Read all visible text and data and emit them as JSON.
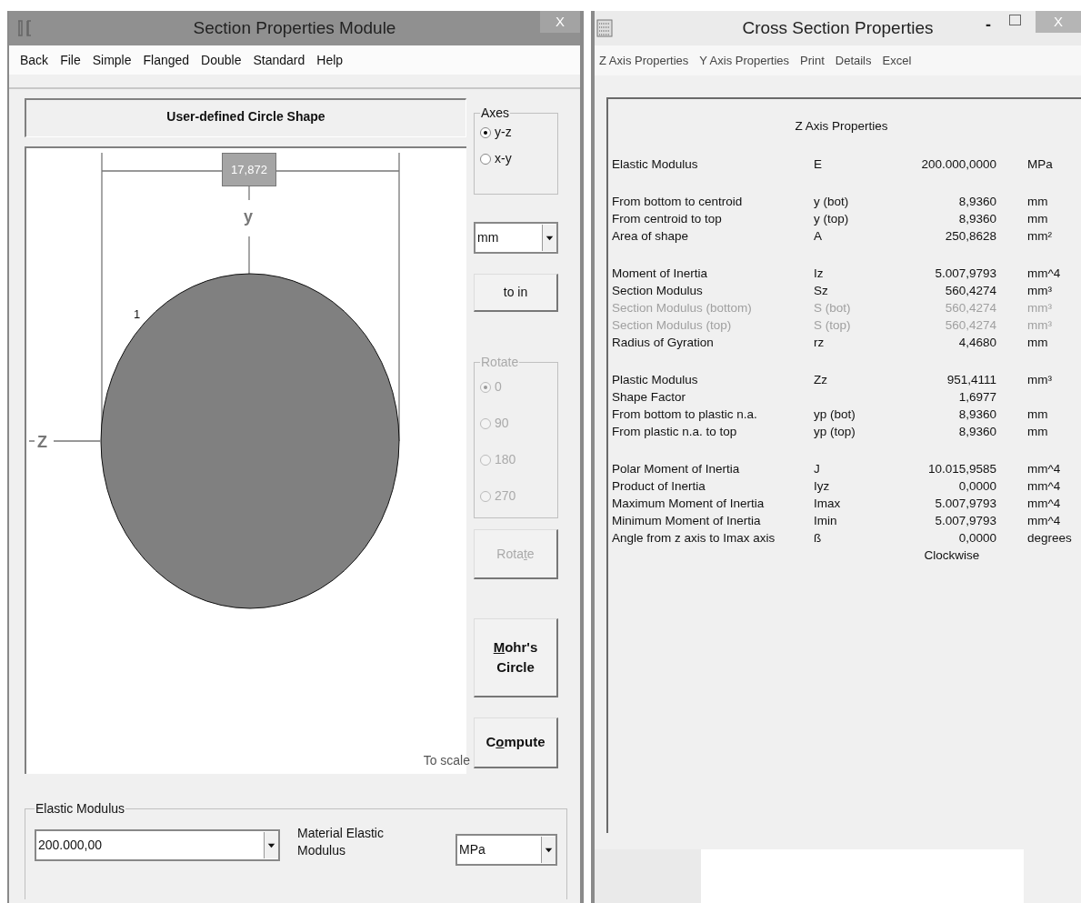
{
  "left_window": {
    "title": "Section Properties Module",
    "close": "X",
    "menu": [
      "Back",
      "File",
      "Simple",
      "Flanged",
      "Double",
      "Standard",
      "Help"
    ],
    "shape_title": "User-defined Circle Shape",
    "drawing": {
      "dimension": "17,872",
      "y_axis": "y",
      "z_axis": "Z",
      "point": "1",
      "scale_note": "To scale"
    },
    "axes": {
      "label": "Axes",
      "options": [
        {
          "label": "y-z",
          "selected": true
        },
        {
          "label": "x-y",
          "selected": false
        }
      ]
    },
    "unit_select": "mm",
    "convert_button": "to in",
    "rotate": {
      "label": "Rotate",
      "disabled": true,
      "options": [
        {
          "label": "0",
          "selected": true
        },
        {
          "label": "90",
          "selected": false
        },
        {
          "label": "180",
          "selected": false
        },
        {
          "label": "270",
          "selected": false
        }
      ]
    },
    "buttons": [
      {
        "kind": "rotate",
        "label": "Rotate",
        "disabled": true
      },
      {
        "kind": "mohr",
        "label": "Mohr's Circle",
        "disabled": false
      },
      {
        "kind": "compute",
        "label": "Compute",
        "disabled": false
      }
    ],
    "elastic_modulus": {
      "label": "Elastic Modulus",
      "value": "200.000,00",
      "description": "Material Elastic Modulus",
      "unit": "MPa"
    }
  },
  "right_window": {
    "title": "Cross Section Properties",
    "minimize": "-",
    "close": "X",
    "menu": [
      "Z Axis Properties",
      "Y Axis Properties",
      "Print",
      "Details",
      "Excel"
    ],
    "heading": "Z Axis Properties",
    "groups": [
      [
        {
          "label": "Elastic Modulus",
          "symbol": "E",
          "value": "200.000,0000",
          "unit": "MPa",
          "disabled": false
        }
      ],
      [
        {
          "label": "From bottom to centroid",
          "symbol": "y (bot)",
          "value": "8,9360",
          "unit": "mm",
          "disabled": false
        },
        {
          "label": "From centroid to top",
          "symbol": "y (top)",
          "value": "8,9360",
          "unit": "mm",
          "disabled": false
        },
        {
          "label": "Area of shape",
          "symbol": "A",
          "value": "250,8628",
          "unit": "mm²",
          "disabled": false
        }
      ],
      [
        {
          "label": "Moment of Inertia",
          "symbol": "Iz",
          "value": "5.007,9793",
          "unit": "mm^4",
          "disabled": false
        },
        {
          "label": "Section Modulus",
          "symbol": "Sz",
          "value": "560,4274",
          "unit": "mm³",
          "disabled": false
        },
        {
          "label": "Section Modulus (bottom)",
          "symbol": "S (bot)",
          "value": "560,4274",
          "unit": "mm³",
          "disabled": true
        },
        {
          "label": "Section Modulus (top)",
          "symbol": "S (top)",
          "value": "560,4274",
          "unit": "mm³",
          "disabled": true
        },
        {
          "label": "Radius of Gyration",
          "symbol": "rz",
          "value": "4,4680",
          "unit": "mm",
          "disabled": false
        }
      ],
      [
        {
          "label": "Plastic Modulus",
          "symbol": "Zz",
          "value": "951,4111",
          "unit": "mm³",
          "disabled": false
        },
        {
          "label": "Shape Factor",
          "value": "1,6977",
          "disabled": false
        },
        {
          "label": "From bottom to plastic n.a.",
          "symbol": "yp (bot)",
          "value": "8,9360",
          "unit": "mm",
          "disabled": false
        },
        {
          "label": "From plastic n.a. to top",
          "symbol": "yp (top)",
          "value": "8,9360",
          "unit": "mm",
          "disabled": false
        }
      ],
      [
        {
          "label": "Polar Moment of Inertia",
          "symbol": "J",
          "value": "10.015,9585",
          "unit": "mm^4",
          "disabled": false
        },
        {
          "label": "Product of Inertia",
          "symbol": "Iyz",
          "value": "0,0000",
          "unit": "mm^4",
          "disabled": false
        },
        {
          "label": "Maximum Moment of Inertia",
          "symbol": "Imax",
          "value": "5.007,9793",
          "unit": "mm^4",
          "disabled": false
        },
        {
          "label": "Minimum Moment of Inertia",
          "symbol": "Imin",
          "value": "5.007,9793",
          "unit": "mm^4",
          "disabled": false
        },
        {
          "label": "Angle from z axis to Imax axis",
          "symbol": "ß",
          "value": "0,0000",
          "unit": "degrees",
          "disabled": false
        }
      ]
    ],
    "note": "Clockwise"
  }
}
